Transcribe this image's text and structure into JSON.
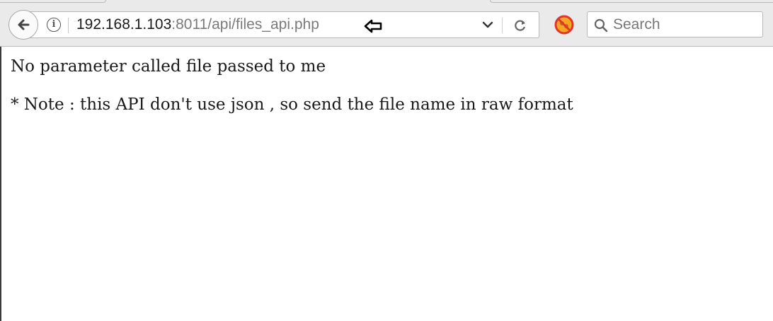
{
  "browser": {
    "url_host": "192.168.1.103",
    "url_rest": ":8011/api/files_api.php",
    "search_placeholder": "Search"
  },
  "page": {
    "message": "No parameter called file passed to me",
    "note": "* Note : this API don't use json , so send the file name in raw format"
  },
  "icons": {
    "back": "back-arrow-icon",
    "info": "info-icon",
    "cursor": "cursor-arrow-icon",
    "dropdown": "chevron-down-icon",
    "reload": "reload-icon",
    "addon": "blocked-addon-icon",
    "search": "search-icon"
  },
  "colors": {
    "toolbar_bg": "#eaeaea",
    "url_host": "#1a1a1a",
    "url_rest": "#7a7a7a",
    "addon_red": "#e0362b",
    "addon_orange": "#f5a623"
  }
}
